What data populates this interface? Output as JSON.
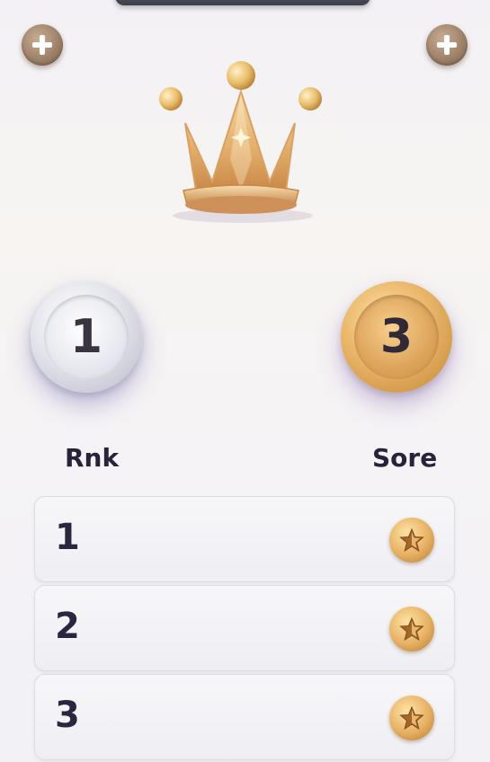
{
  "header": {
    "left_button_icon": "plus-icon",
    "right_button_icon": "plus-icon",
    "crown_icon": "crown-icon"
  },
  "podium": {
    "left_medal": {
      "value": "1",
      "style": "silver"
    },
    "right_medal": {
      "value": "3",
      "style": "gold"
    }
  },
  "table": {
    "rank_label": "Rnk",
    "score_label": "Sore",
    "rows": [
      {
        "rank": "1",
        "score_icon": "star-coin-icon"
      },
      {
        "rank": "2",
        "score_icon": "star-coin-icon"
      },
      {
        "rank": "3",
        "score_icon": "star-coin-icon"
      }
    ]
  },
  "colors": {
    "gold": "#e6b062",
    "silver": "#e4e4ec",
    "text_dark": "#26233a"
  }
}
